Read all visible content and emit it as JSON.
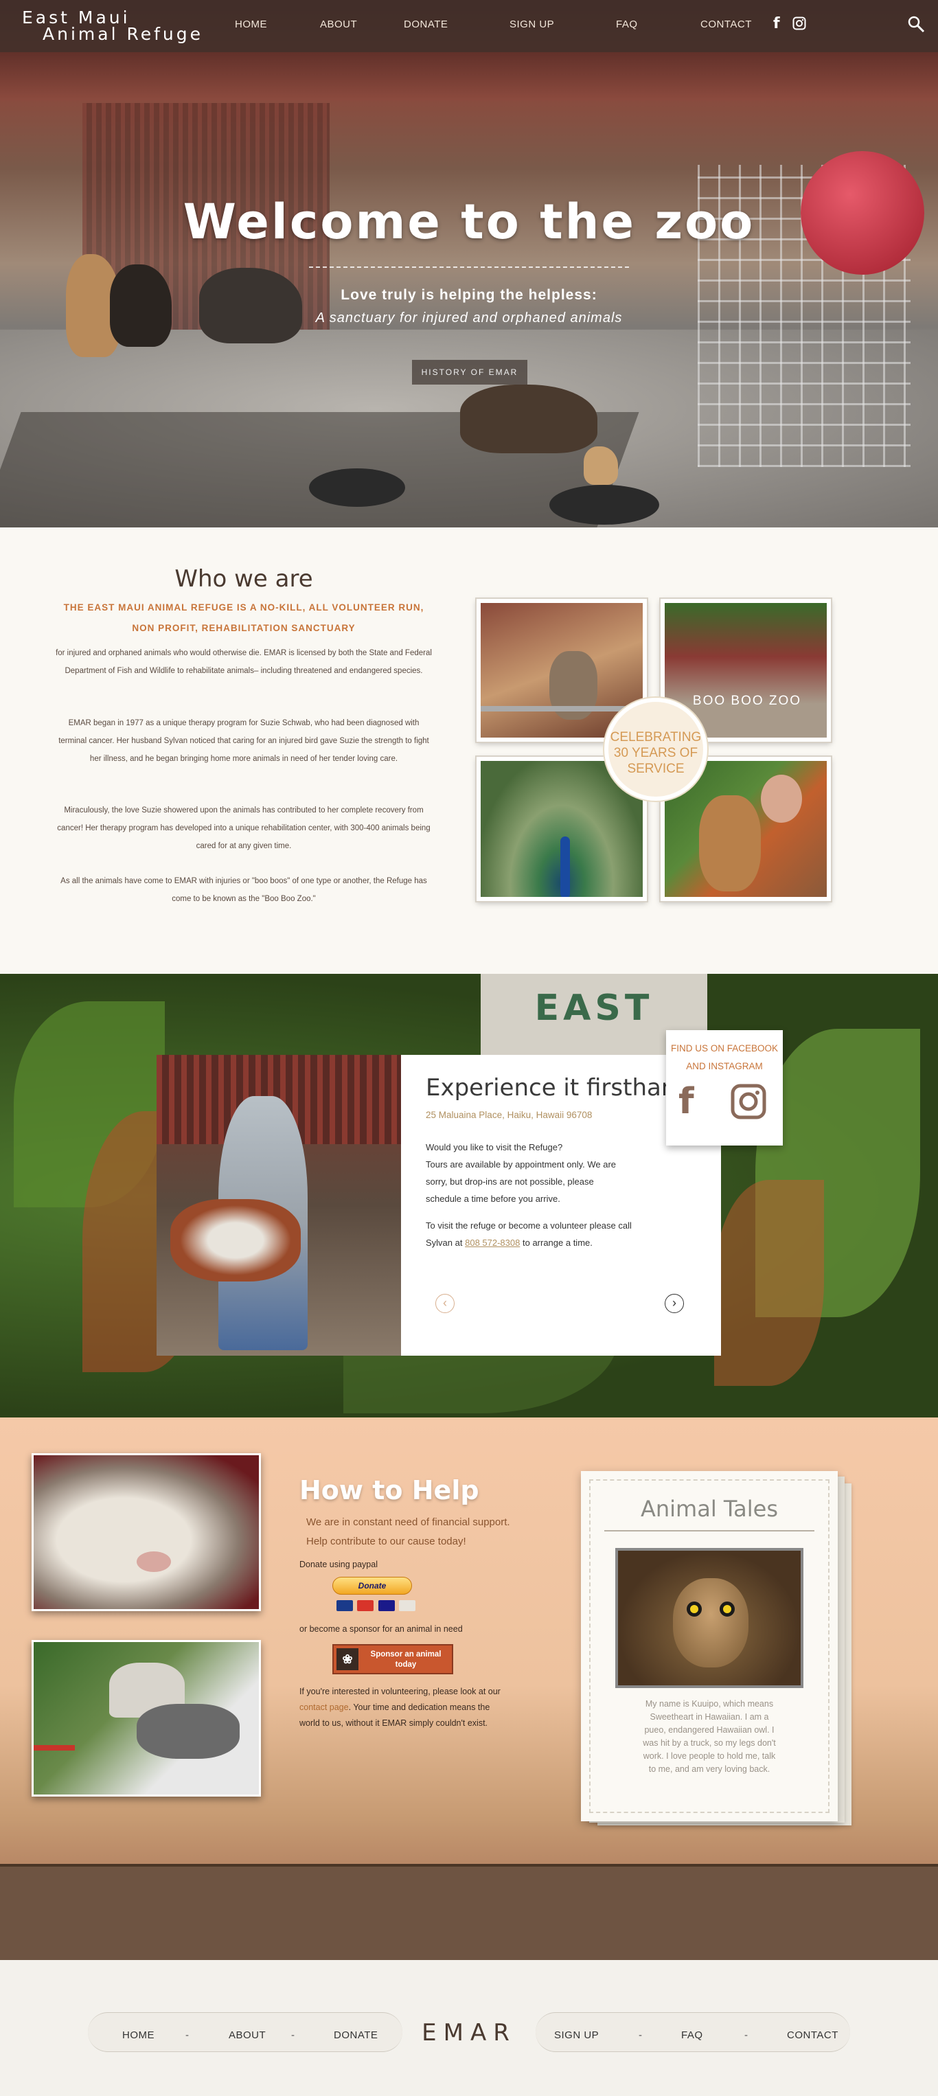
{
  "nav": {
    "logo_line1": "East Maui",
    "logo_line2": "Animal Refuge",
    "links": [
      "HOME",
      "ABOUT",
      "DONATE",
      "SIGN UP",
      "FAQ",
      "CONTACT"
    ]
  },
  "hero": {
    "title": "Welcome to the zoo",
    "subtitle1": "Love truly is helping the helpless:",
    "subtitle2": "A sanctuary for injured and orphaned animals",
    "button": "HISTORY OF EMAR",
    "sign_text": "EAST MAUI ANIMAL"
  },
  "who": {
    "title": "Who we are",
    "lead_line1": "THE EAST MAUI ANIMAL REFUGE IS A NO-KILL, ALL VOLUNTEER RUN,",
    "lead_line2": "NON PROFIT, REHABILITATION SANCTUARY",
    "p1": "for injured and orphaned animals who would otherwise die. EMAR is licensed by both the State and Federal Department of Fish and Wildlife to rehabilitate animals– including threatened and endangered species.",
    "p2": "EMAR began in 1977 as a unique therapy program for Suzie Schwab, who had been diagnosed with terminal cancer. Her husband Sylvan noticed that caring for an injured bird gave Suzie the strength to fight her illness, and he began bringing home more animals in need of her tender loving care.",
    "p3": "Miraculously, the love Suzie showered upon the animals has contributed to her complete recovery from cancer! Her therapy program has developed into a unique rehabilitation center, with 300-400 animals being cared for at any given time.",
    "p4": "As all the animals have come to EMAR with injuries or \"boo boos\" of one type or another, the Refuge has come to be known as the \"Boo Boo Zoo.\"",
    "badge": "CELEBRATING 30 YEARS OF SERVICE",
    "photo_sign": "BOO BOO ZOO"
  },
  "experience": {
    "title": "Experience it firsthand",
    "address": "25 Maluaina Place, Haiku, Hawaii 96708",
    "p1_line1": "Would you like to visit the Refuge?",
    "p1_line2": "Tours are available by appointment only. We are sorry, but drop-ins are not possible, please schedule a time before you arrive.",
    "p2_pre": "To visit the refuge or become a volunteer please call Sylvan at",
    "phone": "808 572-8308",
    "p2_post": "to arrange a time.",
    "social_label_line1": "FIND US ON FACEBOOK",
    "social_label_line2": "AND INSTAGRAM"
  },
  "help": {
    "title": "How to Help",
    "sub1": "We are in constant need of financial support.",
    "sub2": "Help contribute to our cause today!",
    "donate_label": "Donate using paypal",
    "donate_button": "Donate",
    "sponsor_text": "or become a sponsor for an animal in need",
    "sponsor_button": "Sponsor an animal today",
    "volunteer_pre": "If you're interested in volunteering, please look at our",
    "volunteer_link": "contact page",
    "volunteer_post": ". Your time and dedication means the world to us, without it EMAR simply couldn't exist."
  },
  "tales": {
    "title": "Animal Tales",
    "story": "My name is Kuuipo, which means Sweetheart in Hawaiian. I am a pueo, endangered Hawaiian owl. I was hit by a truck, so my legs don't work. I love people to hold me, talk to me, and am very loving back."
  },
  "footer": {
    "logo": "EMAR",
    "left_links": [
      "HOME",
      "ABOUT",
      "DONATE"
    ],
    "right_links": [
      "SIGN UP",
      "FAQ",
      "CONTACT"
    ],
    "separator": "-"
  },
  "colors": {
    "accent_orange": "#c8753a",
    "gold": "#b09060",
    "nav_bg": "#322a26",
    "help_bg": "#f5c9a8",
    "footer_bg": "#f3f1ec"
  },
  "icons": [
    "facebook-icon",
    "instagram-icon",
    "search-icon",
    "chevron-left-icon",
    "chevron-right-icon",
    "paw-icon"
  ]
}
